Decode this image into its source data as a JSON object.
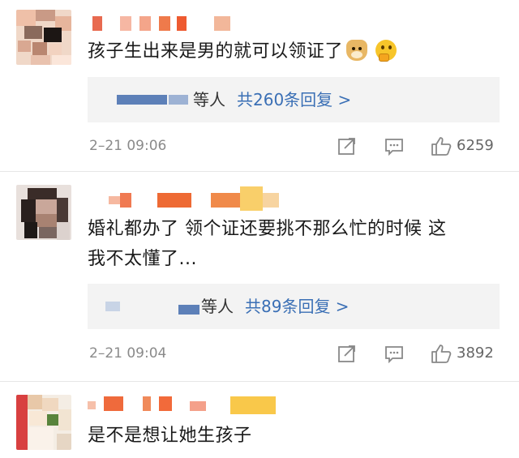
{
  "comments": [
    {
      "text": "孩子生出来是男的就可以领证了",
      "emojis": [
        "doge-icon",
        "thinking-face-icon"
      ],
      "reply_prefix": "等人",
      "reply_link": "共260条回复 >",
      "timestamp": "2–21 09:06",
      "likes": "6259"
    },
    {
      "text_line1": "婚礼都办了 领个证还要挑不那么忙的时候 这",
      "text_line2": "我不太懂了...",
      "reply_prefix": "等人",
      "reply_link": "共89条回复 >",
      "timestamp": "2–21 09:04",
      "likes": "3892"
    },
    {
      "text": "是不是想让她生孩子"
    }
  ],
  "icons": {
    "share": "share-icon",
    "comment": "comment-icon",
    "like": "thumbs-up-icon"
  },
  "colors": {
    "link": "#3a6fb5",
    "meta": "#8a8a8a",
    "reply_bg": "#f3f3f3"
  }
}
